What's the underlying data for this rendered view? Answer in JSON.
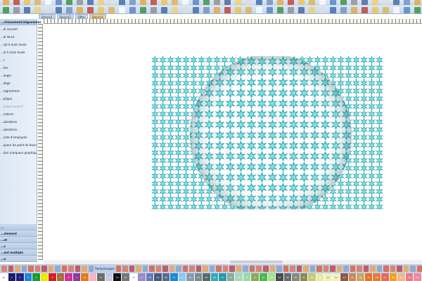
{
  "tabs": [
    "Dessin1",
    "Dessin2",
    "Offre",
    "Dessin3"
  ],
  "sidebar": {
    "header": "...chissement/alignement",
    "items": [
      {
        "label": "...al courant"
      },
      {
        "label": "...al lancé"
      },
      {
        "label": "...rpt à main levée"
      },
      {
        "label": "...al à main levée"
      },
      {
        "label": "...r"
      },
      {
        "label": "...tier"
      },
      {
        "label": "...angle"
      },
      {
        "label": "...llage"
      },
      {
        "label": "...rogrammes"
      },
      {
        "label": "...plique"
      },
      {
        "label": "...plique avancé",
        "disabled": true
      },
      {
        "label": "...roderie"
      },
      {
        "label": "...ubroderie"
      },
      {
        "label": "...ubroderie"
      },
      {
        "label": "...cote d'empiquée"
      },
      {
        "label": "...queur de point de bourrage"
      },
      {
        "label": "...tion marqueur graphique"
      }
    ],
    "bottom_items": [
      "...",
      "...alement",
      "...et",
      "...s",
      "...ent multiple",
      "...e"
    ]
  },
  "bottom_toolbar": {
    "label": "Remplissages"
  },
  "accent": "#3ec4cc",
  "palette": [
    "#1c1c6e",
    "#22227a",
    "#1e88d8",
    "#1a9a3a",
    "#f2e600",
    "#d81e1e",
    "#a86a3a",
    "#d0309a",
    "#8a3a9a",
    "#e87a1a",
    "#f2b4c0",
    "#6a6a6a",
    "#c8c8e0",
    "#111111",
    "#777777",
    "#ffffff",
    "#9a8ac8",
    "#6a7ab8",
    "#4a5a7a",
    "#5a6a8a",
    "#1a8ad0",
    "#8ac8f0",
    "#8a9aaa",
    "#7a8a8a",
    "#5a6a6a",
    "#3aa8b8",
    "#2a9aa8",
    "#8aaa9a",
    "#a8d8b8",
    "#9ad8a8",
    "#8aaa5a",
    "#4ab84a",
    "#a8e08a",
    "#4a4a4a",
    "#6a6a6a",
    "#8a8a7a",
    "#8a8a5a",
    "#c8c87a",
    "#e8e8a8",
    "#f0f0b8",
    "#f0f0c0",
    "#8a5a4a",
    "#c88a5a",
    "#c8a86a",
    "#e8702a",
    "#e87a3a",
    "#e86a5a",
    "#f0a020",
    "#f0b888",
    "#e87a8a",
    "#f08aa0"
  ]
}
